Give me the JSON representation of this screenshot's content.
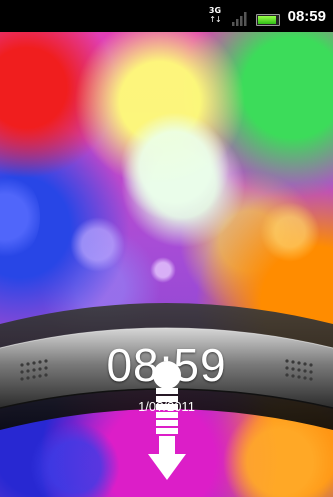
{
  "status_bar": {
    "network_type": "3G",
    "network_arrows": "↑↓",
    "signal_icon": "signal-bars-icon",
    "battery_icon": "battery-icon",
    "battery_level": 0.9,
    "time": "08:59"
  },
  "lock_screen": {
    "time": "08:59",
    "date": "1/0?/2011",
    "unlock_handle_icon": "unlock-drag-down-arrow-icon"
  },
  "colors": {
    "status_bar_bg": "#000000",
    "battery_green": "#3fd018",
    "text": "#ffffff",
    "arc_dark": "#222222",
    "arc_silver": "#9a9a9a"
  }
}
